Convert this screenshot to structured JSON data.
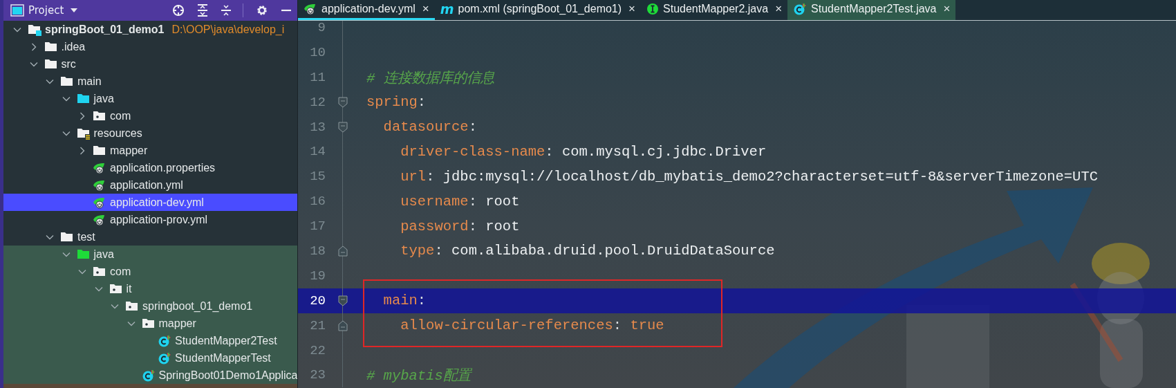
{
  "sidebar": {
    "title": "Project",
    "tree": [
      {
        "label": "springBoot_01_demo1",
        "kind": "module",
        "path": "D:\\OOP\\java\\develop_i",
        "expanded": true,
        "selected": false,
        "test_source": false,
        "children": [
          {
            "label": ".idea",
            "kind": "folder",
            "expanded": false,
            "selected": false,
            "test_source": false
          },
          {
            "label": "src",
            "kind": "folder",
            "expanded": true,
            "selected": false,
            "test_source": false,
            "children": [
              {
                "label": "main",
                "kind": "folder",
                "expanded": true,
                "selected": false,
                "test_source": false,
                "children": [
                  {
                    "label": "java",
                    "kind": "source-folder",
                    "expanded": true,
                    "selected": false,
                    "test_source": false,
                    "children": [
                      {
                        "label": "com",
                        "kind": "package",
                        "expanded": false,
                        "selected": false,
                        "test_source": false
                      }
                    ]
                  },
                  {
                    "label": "resources",
                    "kind": "resources-folder",
                    "expanded": true,
                    "selected": false,
                    "test_source": false,
                    "children": [
                      {
                        "label": "mapper",
                        "kind": "folder",
                        "expanded": false,
                        "selected": false,
                        "test_source": false
                      },
                      {
                        "label": "application.properties",
                        "kind": "spring-config",
                        "selected": false,
                        "test_source": false
                      },
                      {
                        "label": "application.yml",
                        "kind": "spring-config",
                        "selected": false,
                        "test_source": false
                      },
                      {
                        "label": "application-dev.yml",
                        "kind": "spring-config",
                        "selected": true,
                        "test_source": false
                      },
                      {
                        "label": "application-prov.yml",
                        "kind": "spring-config",
                        "selected": false,
                        "test_source": false
                      }
                    ]
                  }
                ]
              },
              {
                "label": "test",
                "kind": "folder",
                "expanded": true,
                "selected": false,
                "test_source": false,
                "children": [
                  {
                    "label": "java",
                    "kind": "test-folder",
                    "expanded": true,
                    "selected": false,
                    "test_source": true,
                    "children": [
                      {
                        "label": "com",
                        "kind": "package",
                        "expanded": true,
                        "selected": false,
                        "test_source": true,
                        "children": [
                          {
                            "label": "it",
                            "kind": "package",
                            "expanded": true,
                            "selected": false,
                            "test_source": true,
                            "children": [
                              {
                                "label": "springboot_01_demo1",
                                "kind": "package",
                                "expanded": true,
                                "selected": false,
                                "test_source": true,
                                "children": [
                                  {
                                    "label": "mapper",
                                    "kind": "package",
                                    "expanded": true,
                                    "selected": false,
                                    "test_source": true,
                                    "children": [
                                      {
                                        "label": "StudentMapper2Test",
                                        "kind": "runnable-class",
                                        "selected": false,
                                        "test_source": true
                                      },
                                      {
                                        "label": "StudentMapperTest",
                                        "kind": "runnable-class",
                                        "selected": false,
                                        "test_source": true
                                      }
                                    ]
                                  },
                                  {
                                    "label": "SpringBoot01Demo1Applica",
                                    "kind": "runnable-class",
                                    "selected": false,
                                    "test_source": true
                                  }
                                ]
                              }
                            ]
                          }
                        ]
                      }
                    ]
                  }
                ]
              }
            ]
          }
        ]
      }
    ]
  },
  "editor": {
    "tabs": [
      {
        "label": "application-dev.yml",
        "kind": "spring-config",
        "selected": true,
        "test_source": false,
        "close": "×"
      },
      {
        "label": "pom.xml (springBoot_01_demo1)",
        "kind": "maven",
        "icon_text": "m",
        "selected": false,
        "test_source": false,
        "close": "×"
      },
      {
        "label": "StudentMapper2.java",
        "kind": "interface",
        "selected": false,
        "test_source": false,
        "close": "×"
      },
      {
        "label": "StudentMapper2Test.java",
        "kind": "runnable-class",
        "selected": false,
        "test_source": true,
        "close": "×"
      }
    ],
    "lines": [
      {
        "number": "9",
        "kind": "plain",
        "current": false,
        "boxed": false
      },
      {
        "number": "10",
        "kind": "plain",
        "current": false,
        "boxed": false
      },
      {
        "number": "11",
        "kind": "plain",
        "current": false,
        "boxed": false,
        "tokens": [
          {
            "kind": "comment",
            "text": "# 连接数据库的信息"
          }
        ]
      },
      {
        "number": "12",
        "kind": "fold-start",
        "current": false,
        "boxed": false,
        "tokens": [
          {
            "kind": "key",
            "text": "spring"
          },
          {
            "kind": "punct",
            "text": ":"
          }
        ]
      },
      {
        "number": "13",
        "kind": "fold-start",
        "current": false,
        "boxed": false,
        "tokens": [
          {
            "kind": "key",
            "text": "  datasource"
          },
          {
            "kind": "punct",
            "text": ":"
          }
        ]
      },
      {
        "number": "14",
        "kind": "plain",
        "current": false,
        "boxed": false,
        "tokens": [
          {
            "kind": "key",
            "text": "    driver-class-name"
          },
          {
            "kind": "punct",
            "text": ":"
          },
          {
            "kind": "value",
            "text": " com.mysql.cj.jdbc.Driver"
          }
        ]
      },
      {
        "number": "15",
        "kind": "plain",
        "current": false,
        "boxed": false,
        "tokens": [
          {
            "kind": "key",
            "text": "    url"
          },
          {
            "kind": "punct",
            "text": ":"
          },
          {
            "kind": "value",
            "text": " jdbc:mysql://localhost/db_mybatis_demo2?characterset=utf-8&serverTimezone=UTC"
          }
        ]
      },
      {
        "number": "16",
        "kind": "plain",
        "current": false,
        "boxed": false,
        "tokens": [
          {
            "kind": "key",
            "text": "    username"
          },
          {
            "kind": "punct",
            "text": ":"
          },
          {
            "kind": "value",
            "text": " root"
          }
        ]
      },
      {
        "number": "17",
        "kind": "plain",
        "current": false,
        "boxed": false,
        "tokens": [
          {
            "kind": "key",
            "text": "    password"
          },
          {
            "kind": "punct",
            "text": ":"
          },
          {
            "kind": "value",
            "text": " root"
          }
        ]
      },
      {
        "number": "18",
        "kind": "fold-end",
        "current": false,
        "boxed": false,
        "tokens": [
          {
            "kind": "key",
            "text": "    type"
          },
          {
            "kind": "punct",
            "text": ":"
          },
          {
            "kind": "value",
            "text": " com.alibaba.druid.pool.DruidDataSource"
          }
        ]
      },
      {
        "number": "19",
        "kind": "plain",
        "current": false,
        "boxed": false
      },
      {
        "number": "20",
        "kind": "fold-start",
        "current": true,
        "boxed": true,
        "tokens": [
          {
            "kind": "key",
            "text": "  main"
          },
          {
            "kind": "punct",
            "text": ":"
          }
        ]
      },
      {
        "number": "21",
        "kind": "fold-end",
        "current": false,
        "boxed": true,
        "tokens": [
          {
            "kind": "key",
            "text": "    allow-circular-references"
          },
          {
            "kind": "punct",
            "text": ":"
          },
          {
            "kind": "keyword",
            "text": " true"
          }
        ]
      },
      {
        "number": "22",
        "kind": "plain",
        "current": false,
        "boxed": true
      },
      {
        "number": "23",
        "kind": "plain",
        "current": false,
        "boxed": false,
        "tokens": [
          {
            "kind": "comment",
            "text": "# mybatis配置"
          }
        ]
      }
    ]
  }
}
